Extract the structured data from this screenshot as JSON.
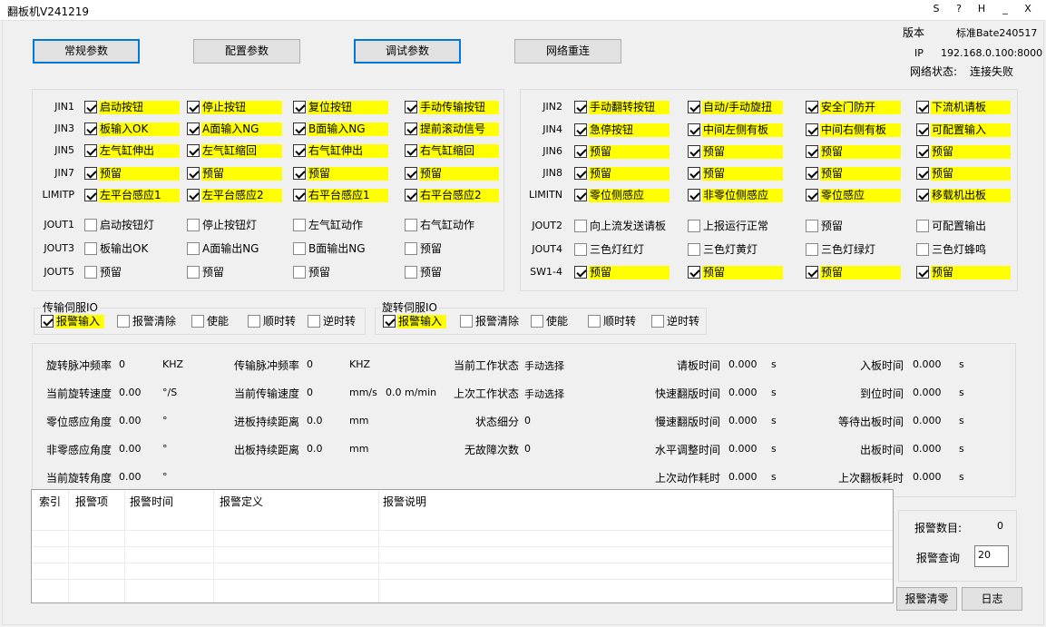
{
  "window": {
    "title": "翻板机V241219",
    "buttons": [
      "S",
      "?",
      "H",
      "_",
      "X"
    ]
  },
  "top_buttons": [
    "常规参数",
    "配置参数",
    "调试参数",
    "网络重连"
  ],
  "info": {
    "version_label": "版本",
    "version_value": "标准Bate240517",
    "ip_label": "IP",
    "ip_value": "192.168.0.100:8000",
    "net_label": "网络状态:",
    "net_value": "连接失败"
  },
  "left_panel": {
    "rows": [
      {
        "label": "JIN1",
        "items": [
          {
            "t": "启动按钮",
            "c": true,
            "y": true
          },
          {
            "t": "停止按钮",
            "c": true,
            "y": true
          },
          {
            "t": "复位按钮",
            "c": true,
            "y": true
          },
          {
            "t": "手动传输按钮",
            "c": true,
            "y": true
          }
        ]
      },
      {
        "label": "JIN3",
        "items": [
          {
            "t": "板输入OK",
            "c": true,
            "y": true
          },
          {
            "t": "A面输入NG",
            "c": true,
            "y": true
          },
          {
            "t": "B面输入NG",
            "c": true,
            "y": true
          },
          {
            "t": "提前滚动信号",
            "c": true,
            "y": true
          }
        ]
      },
      {
        "label": "JIN5",
        "items": [
          {
            "t": "左气缸伸出",
            "c": true,
            "y": true
          },
          {
            "t": "左气缸缩回",
            "c": true,
            "y": true
          },
          {
            "t": "右气缸伸出",
            "c": true,
            "y": true
          },
          {
            "t": "右气缸缩回",
            "c": true,
            "y": true
          }
        ]
      },
      {
        "label": "JIN7",
        "items": [
          {
            "t": "预留",
            "c": true,
            "y": true
          },
          {
            "t": "预留",
            "c": true,
            "y": true
          },
          {
            "t": "预留",
            "c": true,
            "y": true
          },
          {
            "t": "预留",
            "c": true,
            "y": true
          }
        ]
      },
      {
        "label": "LIMITP",
        "items": [
          {
            "t": "左平台感应1",
            "c": true,
            "y": true
          },
          {
            "t": "左平台感应2",
            "c": true,
            "y": true
          },
          {
            "t": "右平台感应1",
            "c": true,
            "y": true
          },
          {
            "t": "右平台感应2",
            "c": true,
            "y": true
          }
        ]
      },
      {
        "label": "JOUT1",
        "items": [
          {
            "t": "启动按钮灯",
            "c": false,
            "y": false
          },
          {
            "t": "停止按钮灯",
            "c": false,
            "y": false
          },
          {
            "t": "左气缸动作",
            "c": false,
            "y": false
          },
          {
            "t": "右气缸动作",
            "c": false,
            "y": false
          }
        ]
      },
      {
        "label": "JOUT3",
        "items": [
          {
            "t": "板输出OK",
            "c": false,
            "y": false
          },
          {
            "t": "A面输出NG",
            "c": false,
            "y": false
          },
          {
            "t": "B面输出NG",
            "c": false,
            "y": false
          },
          {
            "t": "预留",
            "c": false,
            "y": false
          }
        ]
      },
      {
        "label": "JOUT5",
        "items": [
          {
            "t": "预留",
            "c": false,
            "y": false
          },
          {
            "t": "预留",
            "c": false,
            "y": false
          },
          {
            "t": "预留",
            "c": false,
            "y": false
          },
          {
            "t": "预留",
            "c": false,
            "y": false
          }
        ]
      }
    ]
  },
  "right_panel": {
    "rows": [
      {
        "label": "JIN2",
        "items": [
          {
            "t": "手动翻转按钮",
            "c": true,
            "y": true
          },
          {
            "t": "自动/手动旋扭",
            "c": true,
            "y": true
          },
          {
            "t": "安全门防开",
            "c": true,
            "y": true
          },
          {
            "t": "下流机请板",
            "c": true,
            "y": true
          }
        ]
      },
      {
        "label": "JIN4",
        "items": [
          {
            "t": "急停按钮",
            "c": true,
            "y": true
          },
          {
            "t": "中间左侧有板",
            "c": true,
            "y": true
          },
          {
            "t": "中间右侧有板",
            "c": true,
            "y": true
          },
          {
            "t": "可配置输入",
            "c": true,
            "y": true
          }
        ]
      },
      {
        "label": "JIN6",
        "items": [
          {
            "t": "预留",
            "c": true,
            "y": true
          },
          {
            "t": "预留",
            "c": true,
            "y": true
          },
          {
            "t": "预留",
            "c": true,
            "y": true
          },
          {
            "t": "预留",
            "c": true,
            "y": true
          }
        ]
      },
      {
        "label": "JIN8",
        "items": [
          {
            "t": "预留",
            "c": true,
            "y": true
          },
          {
            "t": "预留",
            "c": true,
            "y": true
          },
          {
            "t": "预留",
            "c": true,
            "y": true
          },
          {
            "t": "预留",
            "c": true,
            "y": true
          }
        ]
      },
      {
        "label": "LIMITN",
        "items": [
          {
            "t": "零位侧感应",
            "c": true,
            "y": true
          },
          {
            "t": "非零位侧感应",
            "c": true,
            "y": true
          },
          {
            "t": "零位感应",
            "c": true,
            "y": true
          },
          {
            "t": "移载机出板",
            "c": true,
            "y": true
          }
        ]
      },
      {
        "label": "JOUT2",
        "items": [
          {
            "t": "向上流发送请板",
            "c": false,
            "y": false
          },
          {
            "t": "上报运行正常",
            "c": false,
            "y": false
          },
          {
            "t": "预留",
            "c": false,
            "y": false
          },
          {
            "t": "可配置输出",
            "c": false,
            "y": false
          }
        ]
      },
      {
        "label": "JOUT4",
        "items": [
          {
            "t": "三色灯红灯",
            "c": false,
            "y": false
          },
          {
            "t": "三色灯黄灯",
            "c": false,
            "y": false
          },
          {
            "t": "三色灯绿灯",
            "c": false,
            "y": false
          },
          {
            "t": "三色灯蜂鸣",
            "c": false,
            "y": false
          }
        ]
      },
      {
        "label": "SW1-4",
        "items": [
          {
            "t": "预留",
            "c": true,
            "y": true
          },
          {
            "t": "预留",
            "c": true,
            "y": true
          },
          {
            "t": "预留",
            "c": true,
            "y": true
          },
          {
            "t": "预留",
            "c": true,
            "y": true
          }
        ]
      }
    ]
  },
  "servo_groups": [
    {
      "title": "传输伺服IO",
      "items": [
        {
          "t": "报警输入",
          "c": true,
          "y": true
        },
        {
          "t": "报警清除",
          "c": false,
          "y": false
        },
        {
          "t": "使能",
          "c": false,
          "y": false
        },
        {
          "t": "顺时转",
          "c": false,
          "y": false
        },
        {
          "t": "逆时转",
          "c": false,
          "y": false
        }
      ]
    },
    {
      "title": "旋转伺服IO",
      "items": [
        {
          "t": "报警输入",
          "c": true,
          "y": true
        },
        {
          "t": "报警清除",
          "c": false,
          "y": false
        },
        {
          "t": "使能",
          "c": false,
          "y": false
        },
        {
          "t": "顺时转",
          "c": false,
          "y": false
        },
        {
          "t": "逆时转",
          "c": false,
          "y": false
        }
      ]
    }
  ],
  "status": {
    "col1": [
      {
        "l": "旋转脉冲频率",
        "v": "0",
        "u": "KHZ"
      },
      {
        "l": "当前旋转速度",
        "v": "0.00",
        "u": "°/S"
      },
      {
        "l": "零位感应角度",
        "v": "0.00",
        "u": "°"
      },
      {
        "l": "非零感应角度",
        "v": "0.00",
        "u": "°"
      },
      {
        "l": "当前旋转角度",
        "v": "0.00",
        "u": "°"
      }
    ],
    "col2": [
      {
        "l": "传输脉冲频率",
        "v": "0",
        "u": "KHZ",
        "x": ""
      },
      {
        "l": "当前传输速度",
        "v": "0",
        "u": "mm/s",
        "x": "0.0 m/min"
      },
      {
        "l": "进板持续距离",
        "v": "0.0",
        "u": "mm",
        "x": ""
      },
      {
        "l": "出板持续距离",
        "v": "0.0",
        "u": "mm",
        "x": ""
      }
    ],
    "col3": [
      {
        "l": "当前工作状态",
        "v": "手动选择"
      },
      {
        "l": "上次工作状态",
        "v": "手动选择"
      },
      {
        "l": "状态细分",
        "v": "0"
      },
      {
        "l": "无故障次数",
        "v": "0"
      }
    ],
    "col4": [
      {
        "l": "请板时间",
        "v": "0.000",
        "u": "s"
      },
      {
        "l": "快速翻版时间",
        "v": "0.000",
        "u": "s"
      },
      {
        "l": "慢速翻版时间",
        "v": "0.000",
        "u": "s"
      },
      {
        "l": "水平调整时间",
        "v": "0.000",
        "u": "s"
      },
      {
        "l": "上次动作耗时",
        "v": "0.000",
        "u": "s"
      }
    ],
    "col5": [
      {
        "l": "入板时间",
        "v": "0.000",
        "u": "s"
      },
      {
        "l": "到位时间",
        "v": "0.000",
        "u": "s"
      },
      {
        "l": "等待出板时间",
        "v": "0.000",
        "u": "s"
      },
      {
        "l": "出板时间",
        "v": "0.000",
        "u": "s"
      },
      {
        "l": "上次翻板耗时",
        "v": "0.000",
        "u": "s"
      }
    ]
  },
  "alarm_table": {
    "headers": [
      "索引",
      "报警项",
      "报警时间",
      "报警定义",
      "报警说明"
    ]
  },
  "alarm_side": {
    "count_label": "报警数目:",
    "count_value": "0",
    "query_label": "报警查询",
    "query_value": "20",
    "clear_button": "报警清零",
    "log_button": "日志"
  }
}
